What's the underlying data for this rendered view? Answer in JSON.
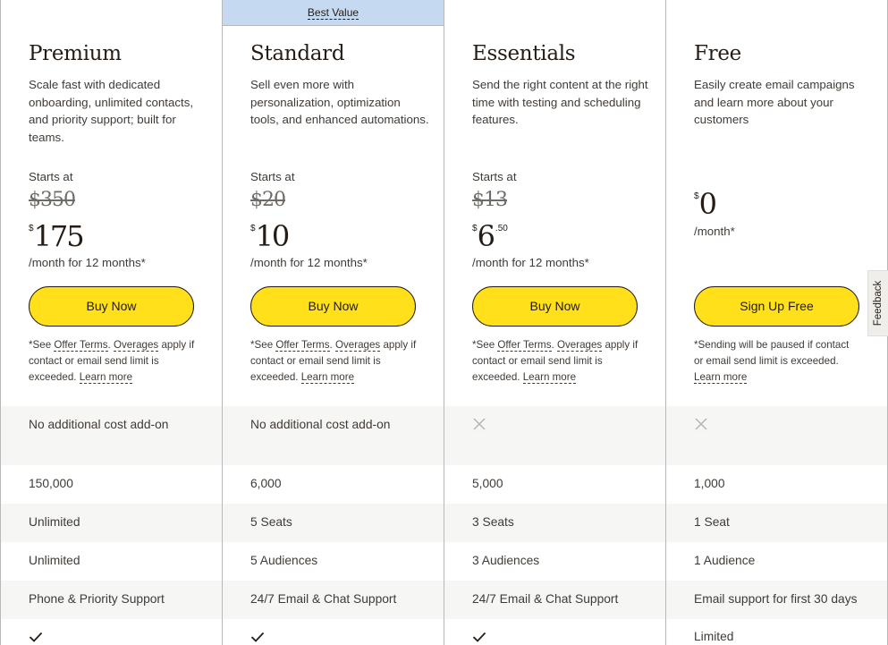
{
  "badge": {
    "label": "Best Value"
  },
  "plans": [
    {
      "name": "Premium",
      "description": "Scale fast with dedicated onboarding, unlimited contacts, and priority support; built for teams.",
      "starts_at": "Starts at",
      "old_price": "$350",
      "currency": "$",
      "price": "175",
      "cents": "",
      "period": "/month for 12 months*",
      "button": "Buy Now",
      "fine_print": {
        "prefix": "*See ",
        "link1": "Offer Terms",
        "sep": ". ",
        "link2": "Overages",
        "middle": " apply if contact or email send limit is exceeded. ",
        "link3": "Learn more"
      }
    },
    {
      "name": "Standard",
      "description": "Sell even more with personalization, optimization tools, and enhanced automations.",
      "starts_at": "Starts at",
      "old_price": "$20",
      "currency": "$",
      "price": "10",
      "cents": "",
      "period": "/month for 12 months*",
      "button": "Buy Now",
      "fine_print": {
        "prefix": "*See ",
        "link1": "Offer Terms",
        "sep": ". ",
        "link2": "Overages",
        "middle": " apply if contact or email send limit is exceeded. ",
        "link3": "Learn more"
      }
    },
    {
      "name": "Essentials",
      "description": "Send the right content at the right time with testing and scheduling features.",
      "starts_at": "Starts at",
      "old_price": "$13",
      "currency": "$",
      "price": "6",
      "cents": ".50",
      "period": "/month for 12 months*",
      "button": "Buy Now",
      "fine_print": {
        "prefix": "*See ",
        "link1": "Offer Terms",
        "sep": ". ",
        "link2": "Overages",
        "middle": " apply if contact or email send limit is exceeded. ",
        "link3": "Learn more"
      }
    },
    {
      "name": "Free",
      "description": "Easily create email campaigns and learn more about your customers",
      "currency": "$",
      "price": "0",
      "period": "/month*",
      "button": "Sign Up Free",
      "fine_print": {
        "prefix": "*Sending will be paused if contact or email send limit is exceeded. ",
        "link3": "Learn more"
      }
    }
  ],
  "features": [
    {
      "values": [
        "No additional cost add-on",
        "No additional cost add-on",
        {
          "icon": "x-icon"
        },
        {
          "icon": "x-icon"
        }
      ]
    },
    {
      "values": [
        "150,000",
        "6,000",
        "5,000",
        "1,000"
      ]
    },
    {
      "values": [
        "Unlimited",
        "5 Seats",
        "3 Seats",
        "1 Seat"
      ]
    },
    {
      "values": [
        "Unlimited",
        "5 Audiences",
        "3 Audiences",
        "1 Audience"
      ]
    },
    {
      "values": [
        "Phone & Priority Support",
        "24/7 Email & Chat Support",
        "24/7 Email & Chat Support",
        "Email support for first 30 days"
      ]
    },
    {
      "values": [
        {
          "icon": "check-icon"
        },
        {
          "icon": "check-icon"
        },
        {
          "icon": "check-icon"
        },
        "Limited"
      ]
    }
  ],
  "feedback": {
    "label": "Feedback"
  },
  "colors": {
    "accent": "#ffe01b",
    "badge_bg": "#c5d9f0",
    "band_gray": "#f6f6f4",
    "text": "#241c15",
    "divider": "#b8b8b8"
  }
}
